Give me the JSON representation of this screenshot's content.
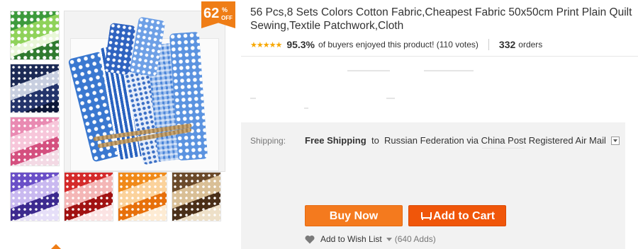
{
  "badge": {
    "number": "62",
    "percent": "%",
    "off": "OFF"
  },
  "title": {
    "line1": "56 Pcs,8 Sets Colors Cotton Fabric,Cheapest Fabric 50x50cm Print Plain Quilt",
    "line2": "Sewing,Textile Patchwork,Cloth"
  },
  "rating": {
    "stars": "★★★★★",
    "percent": "95.3%",
    "percent_text": "of buyers enjoyed this product! (110 votes)",
    "orders_count": "332",
    "orders_label": "orders"
  },
  "shipping": {
    "label": "Shipping:",
    "free": "Free Shipping",
    "to": "to",
    "destination": "Russian Federation via China Post Registered Air Mail"
  },
  "actions": {
    "buy_now": "Buy Now",
    "add_to_cart": "Add to Cart"
  },
  "wishlist": {
    "label": "Add to Wish List",
    "count": "(640 Adds)"
  },
  "colors": {
    "accent_orange": "#f47a1e",
    "cart_orange": "#f0560a",
    "badge_orange": "#ef7d16",
    "star_yellow": "#f7a700"
  }
}
